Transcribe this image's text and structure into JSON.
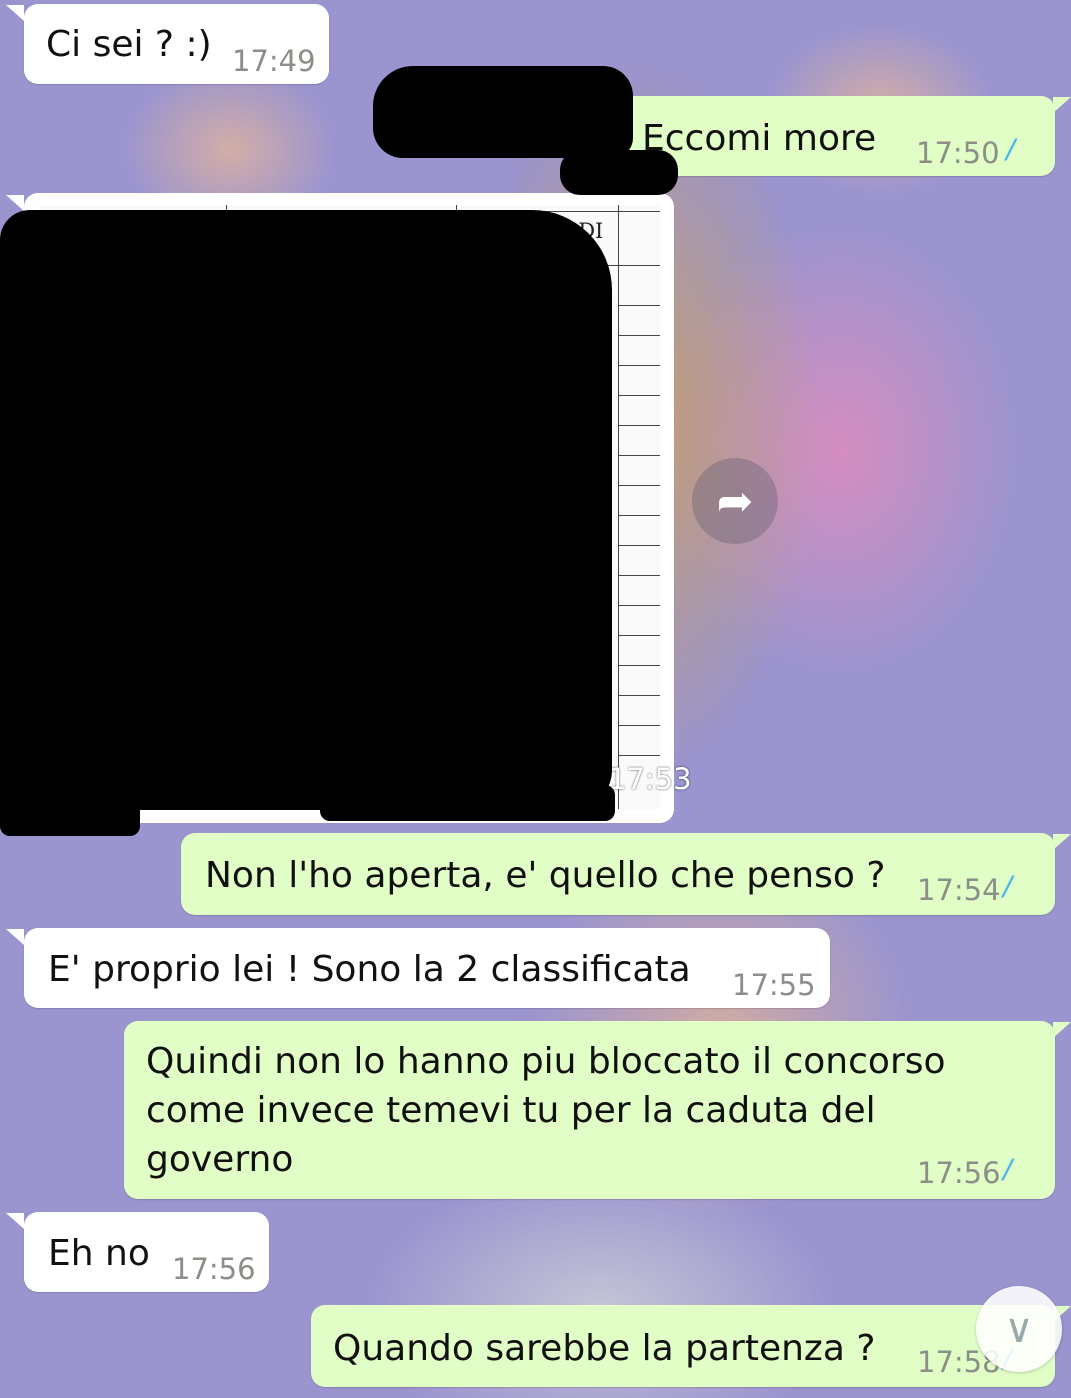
{
  "messages": [
    {
      "text": "Ci sei ? :)",
      "time": "17:49"
    },
    {
      "text": "Eccomi more",
      "time": "17:50",
      "ticks": "//"
    },
    {
      "time": "17:53",
      "doc_header": "DATA DI\nNASCITA"
    },
    {
      "text": "Non l'ho aperta, e' quello che penso ?",
      "time": "17:54",
      "ticks": "//"
    },
    {
      "text": "E' proprio lei ! Sono la 2 classificata",
      "time": "17:55"
    },
    {
      "text": "Quindi non lo hanno piu bloccato il concorso\ncome invece temevi tu per la caduta del\ngoverno",
      "time": "17:56",
      "ticks": "//"
    },
    {
      "text": "Eh no",
      "time": "17:56"
    },
    {
      "text": "Quando sarebbe la partenza ?",
      "time": "17:58",
      "ticks": "//"
    }
  ],
  "icons": {
    "forward": "forward-arrow-icon",
    "scroll_down": "double-chevron-down-icon",
    "read_receipt_color": "#4fb6ec"
  },
  "colors": {
    "incoming_bubble": "#ffffff",
    "outgoing_bubble": "#e1fec6",
    "timestamp": "#8a8f87"
  }
}
